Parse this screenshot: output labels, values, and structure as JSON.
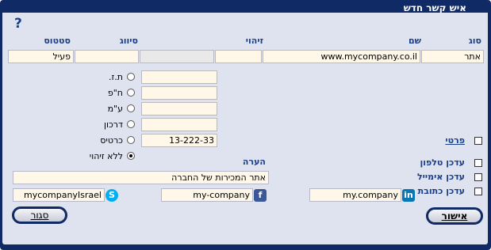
{
  "window": {
    "title": "איש קשר חדש"
  },
  "help": "?",
  "headers": {
    "type": "סוג",
    "name": "שם",
    "id": "זיהוי",
    "classification": "סיווג",
    "status": "סטטוס"
  },
  "row": {
    "type": "אתר",
    "name": "www.mycompany.co.il",
    "id": "",
    "id_extra": "",
    "classification": "",
    "status": "פעיל"
  },
  "id_options": [
    {
      "label": "ת.ז.",
      "value": "",
      "selected": false
    },
    {
      "label": "ח\"פ",
      "value": "",
      "selected": false
    },
    {
      "label": "ע\"מ",
      "value": "",
      "selected": false
    },
    {
      "label": "דרכון",
      "value": "",
      "selected": false
    },
    {
      "label": "כרטיס",
      "value": "13-222-33",
      "selected": false
    },
    {
      "label": "ללא זיהוי",
      "value": "",
      "selected": true
    }
  ],
  "private": {
    "label": "פרטי",
    "checked": false
  },
  "note": {
    "label": "הערה",
    "value": "אתר המכירות של החברה"
  },
  "updates": [
    {
      "label": "עדכן טלפון",
      "checked": false
    },
    {
      "label": "עדכן אימייל",
      "checked": false
    },
    {
      "label": "עדכן כתובת",
      "checked": false
    }
  ],
  "social": {
    "linkedin": {
      "icon": "linkedin-icon",
      "value": "my.company",
      "color": "#0a77b5"
    },
    "facebook": {
      "icon": "facebook-icon",
      "value": "my-company",
      "color": "#3b5998"
    },
    "skype": {
      "icon": "skype-icon",
      "value": "mycompanyIsrael",
      "color": "#00aff0"
    }
  },
  "buttons": {
    "ok": "אישור",
    "close": "סגור"
  }
}
